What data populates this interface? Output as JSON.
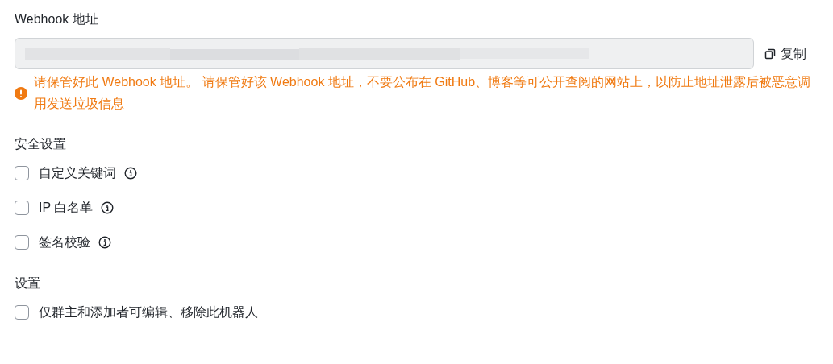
{
  "webhook": {
    "label": "Webhook 地址",
    "copy_label": "复制",
    "warning": "请保管好此 Webhook 地址。 请保管好该 Webhook 地址，不要公布在 GitHub、博客等可公开查阅的网站上，以防止地址泄露后被恶意调用发送垃圾信息"
  },
  "security": {
    "title": "安全设置",
    "options": [
      {
        "label": "自定义关键词",
        "checked": false,
        "info": true
      },
      {
        "label": "IP 白名单",
        "checked": false,
        "info": true
      },
      {
        "label": "签名校验",
        "checked": false,
        "info": true
      }
    ]
  },
  "settings": {
    "title": "设置",
    "options": [
      {
        "label": "仅群主和添加者可编辑、移除此机器人",
        "checked": false,
        "info": false
      }
    ]
  }
}
